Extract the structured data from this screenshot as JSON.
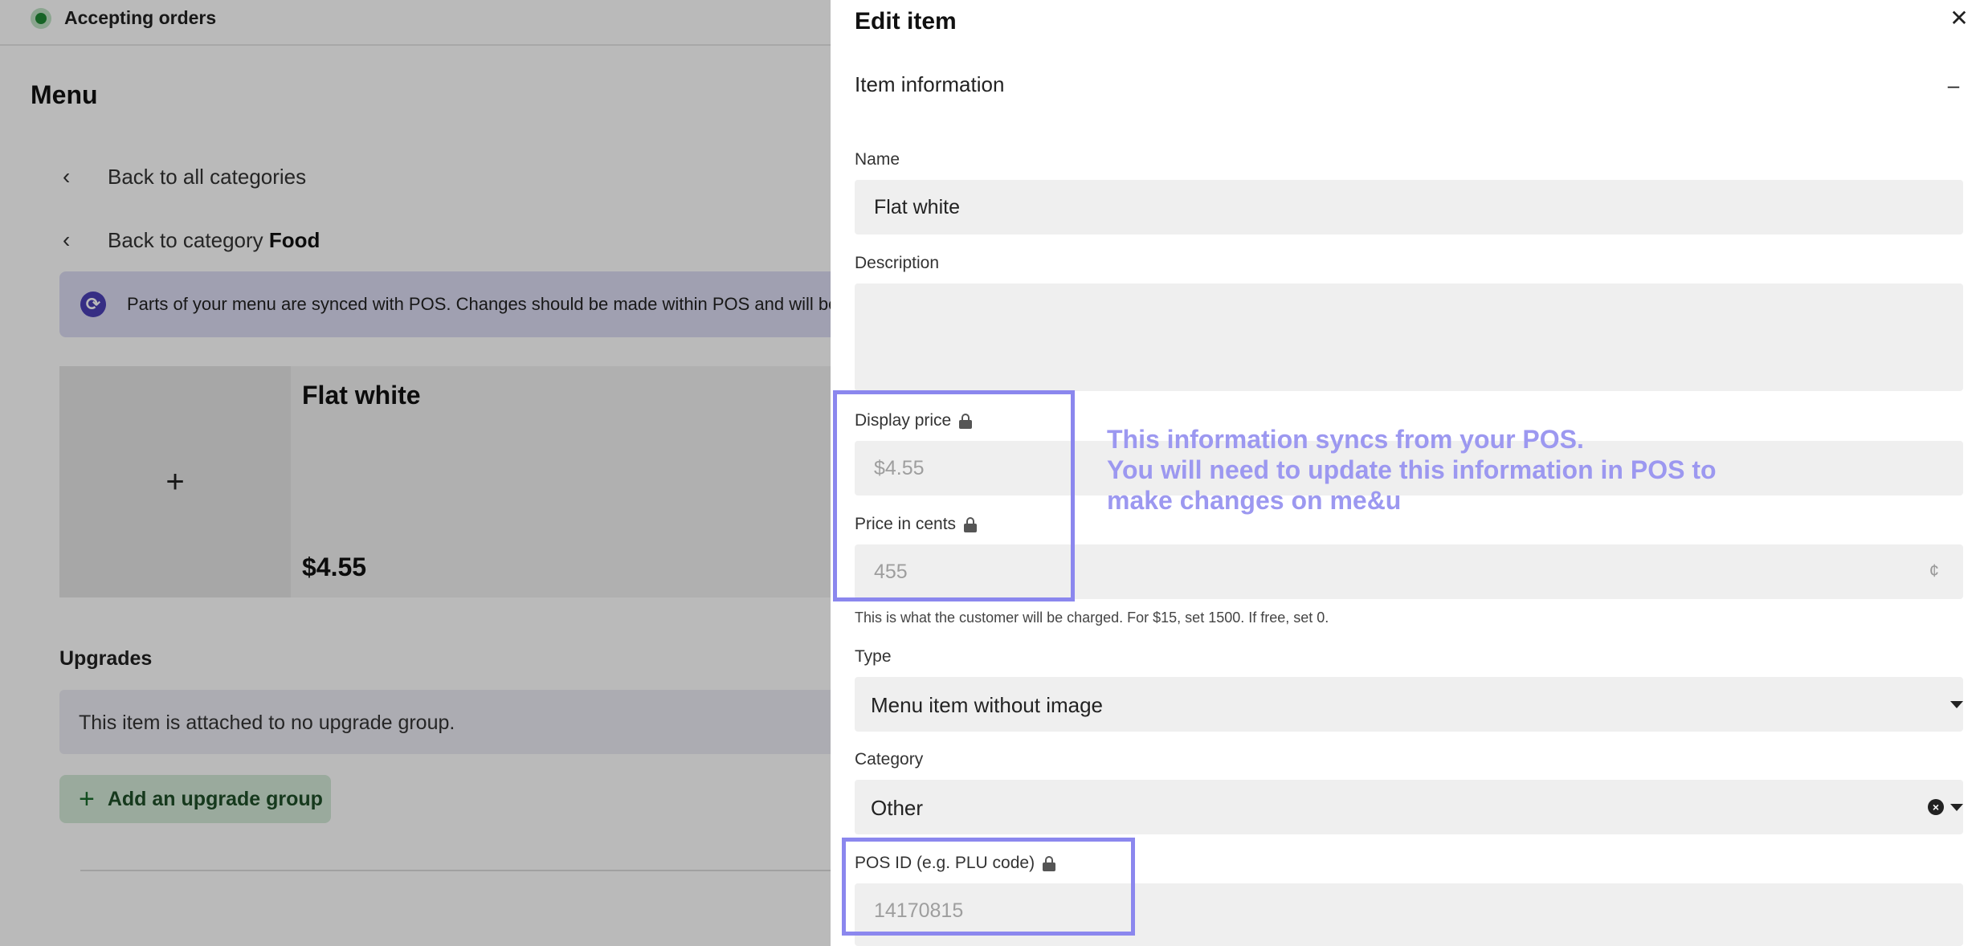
{
  "header": {
    "status": "Accepting orders",
    "status_color": "#1f8a34"
  },
  "menu": {
    "title": "Menu",
    "back_all": "Back to all categories",
    "back_category_prefix": "Back to category",
    "back_category_name": "Food",
    "sync_banner": "Parts of your menu are synced with POS. Changes should be made within POS and will be r",
    "item_card": {
      "name": "Flat white",
      "price": "$4.55"
    },
    "upgrades": {
      "title": "Upgrades",
      "empty_text": "This item is attached to no upgrade group.",
      "add_label": "Add an upgrade group"
    }
  },
  "drawer": {
    "title": "Edit item",
    "close_icon": "close-icon",
    "section_title": "Item information",
    "collapse_symbol": "–",
    "name": {
      "label": "Name",
      "value": "Flat white"
    },
    "description": {
      "label": "Description",
      "value": ""
    },
    "display_price": {
      "label": "Display price",
      "value": "$4.55"
    },
    "price_cents": {
      "label": "Price in cents",
      "value": "455",
      "suffix": "¢"
    },
    "help_text": "This is what the customer will be charged. For $15, set 1500. If free, set 0.",
    "type": {
      "label": "Type",
      "value": "Menu item without image"
    },
    "category": {
      "label": "Category",
      "value": "Other"
    },
    "pos_id": {
      "label": "POS ID (e.g. PLU code)",
      "value": "14170815"
    }
  },
  "annotation": {
    "lines": [
      "This information syncs from your POS.",
      "You will need to update this information in POS to",
      "make changes on me&u"
    ],
    "color": "#8b87ee"
  }
}
